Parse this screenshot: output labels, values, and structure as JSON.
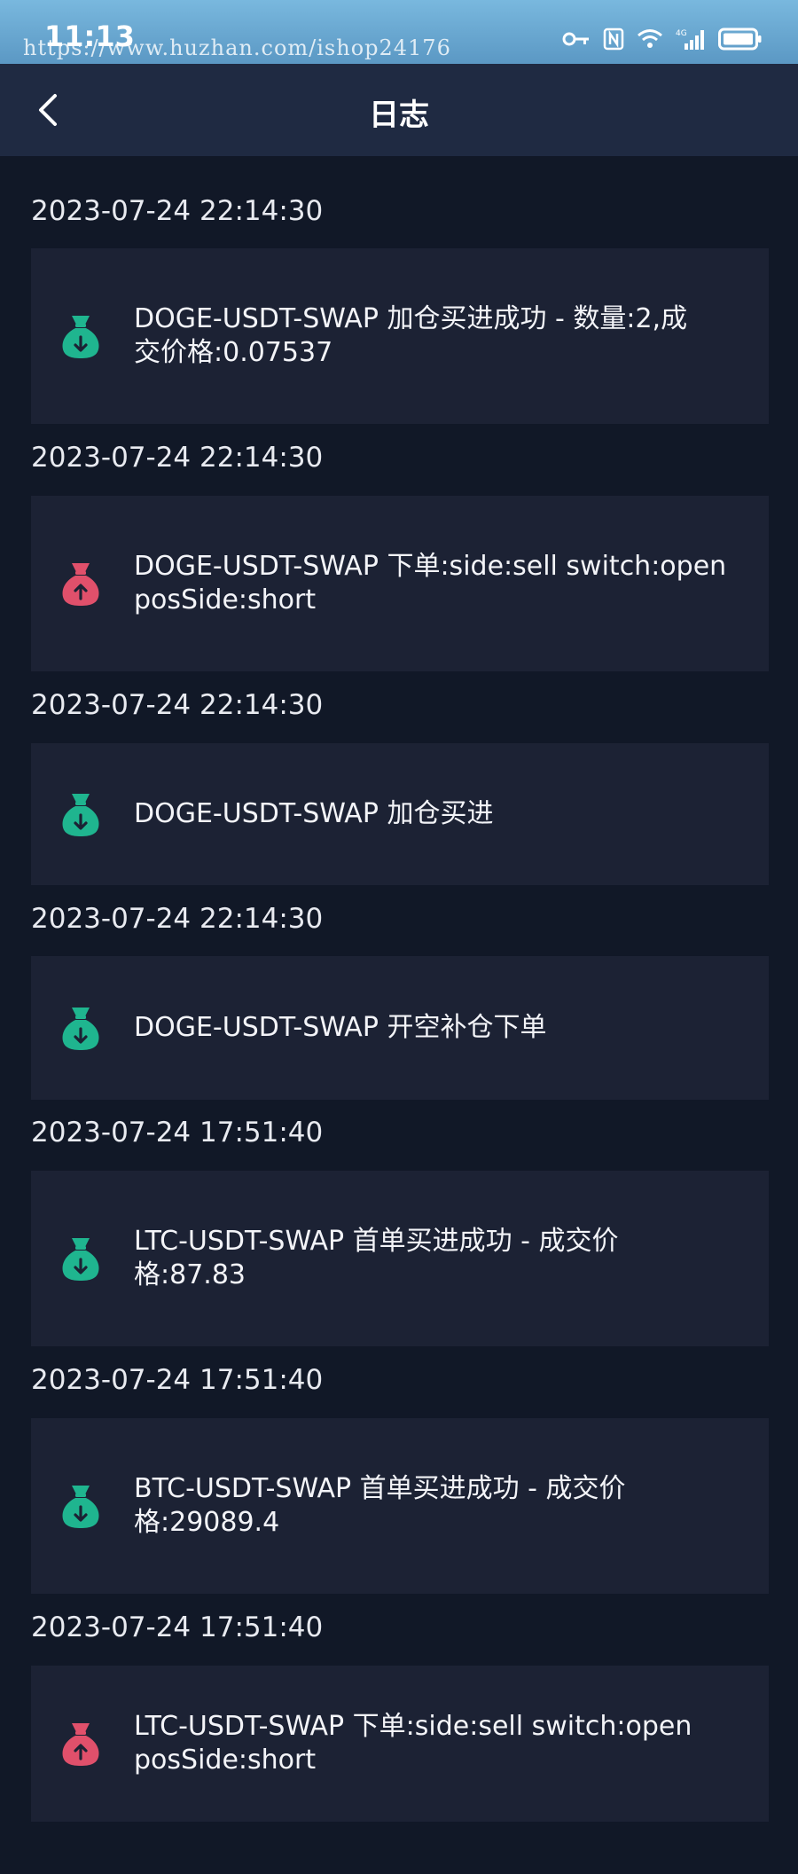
{
  "status_bar": {
    "time": "11:13",
    "watermark": "https://www.huzhan.com/ishop24176",
    "icons": [
      "key-icon",
      "nfc-icon",
      "wifi-icon",
      "signal-4g-icon",
      "battery-icon"
    ]
  },
  "header": {
    "title": "日志",
    "back_icon": "chevron-left-icon"
  },
  "colors": {
    "buy": "#1fb58f",
    "sell": "#e0506b",
    "card_bg": "#1c2234",
    "page_bg": "#111827"
  },
  "logs": [
    {
      "time": "2023-07-24 22:14:30",
      "type": "buy",
      "icon": "money-bag-down-icon",
      "message": "DOGE-USDT-SWAP 加仓买进成功 - 数量:2,成\n交价格:0.07537"
    },
    {
      "time": "2023-07-24 22:14:30",
      "type": "sell",
      "icon": "money-bag-up-icon",
      "message": "DOGE-USDT-SWAP 下单:side:sell switch:open\nposSide:short"
    },
    {
      "time": "2023-07-24 22:14:30",
      "type": "buy",
      "icon": "money-bag-down-icon",
      "message": "DOGE-USDT-SWAP 加仓买进"
    },
    {
      "time": "2023-07-24 22:14:30",
      "type": "buy",
      "icon": "money-bag-down-icon",
      "message": "DOGE-USDT-SWAP 开空补仓下单"
    },
    {
      "time": "2023-07-24 17:51:40",
      "type": "buy",
      "icon": "money-bag-down-icon",
      "message": "LTC-USDT-SWAP 首单买进成功 - 成交价\n格:87.83"
    },
    {
      "time": "2023-07-24 17:51:40",
      "type": "buy",
      "icon": "money-bag-down-icon",
      "message": "BTC-USDT-SWAP 首单买进成功 - 成交价\n格:29089.4"
    },
    {
      "time": "2023-07-24 17:51:40",
      "type": "sell",
      "icon": "money-bag-up-icon",
      "message": "LTC-USDT-SWAP 下单:side:sell switch:open\nposSide:short"
    }
  ]
}
